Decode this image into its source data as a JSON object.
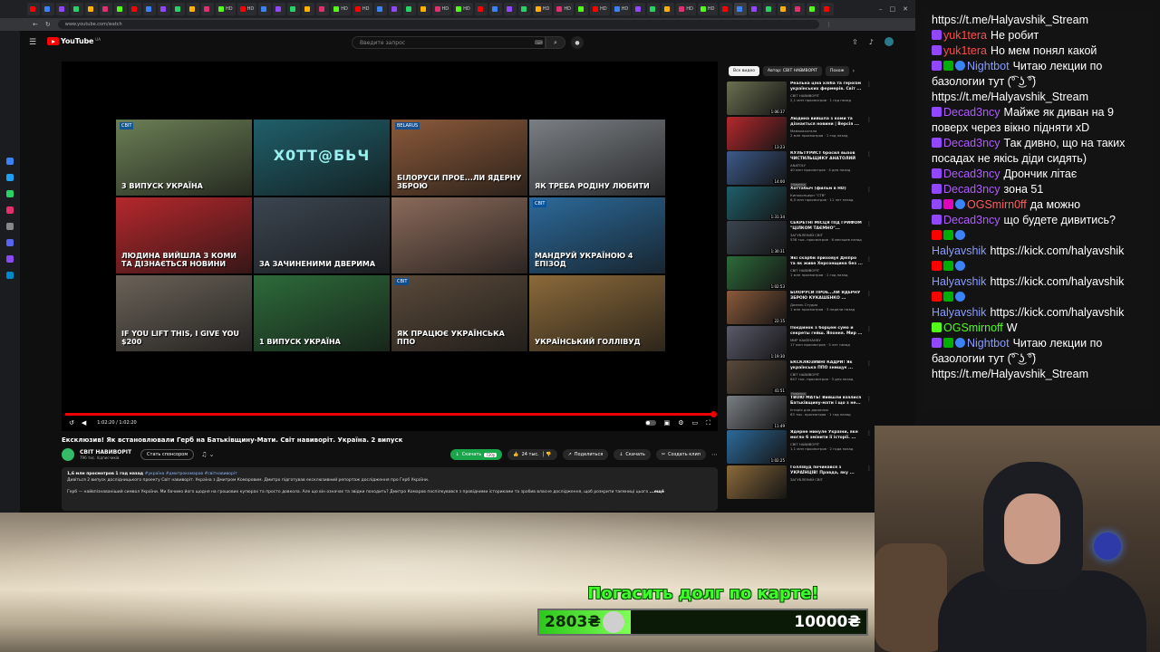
{
  "browser": {
    "tabs": [
      "",
      "",
      "",
      "",
      "",
      "",
      "",
      "",
      "",
      "",
      "",
      "",
      "",
      "HD",
      "HD",
      "",
      "",
      "",
      "",
      "",
      "HD",
      "HD",
      "",
      "",
      "",
      "",
      "HD",
      "HD",
      "",
      "",
      "",
      "",
      "HD",
      "HD",
      "",
      "HD",
      "HD",
      "",
      "",
      "",
      "HD",
      "HD",
      "",
      "",
      "",
      "",
      "",
      "",
      "",
      ""
    ],
    "url": "www.youtube.com/watch"
  },
  "youtube": {
    "logo": "YouTube",
    "logo_region": "UA",
    "search_placeholder": "Введите запрос",
    "player": {
      "time": "1:02:20 / 1:02:20",
      "progress": 1.0,
      "tiles": [
        {
          "badge": "СВІТ",
          "caption": "3 випуск Україна",
          "big": "",
          "bg": "#6b7f55"
        },
        {
          "badge": "",
          "caption": "",
          "big": "Х0ТТ@БЬЧ",
          "bg": "#1f5f6a"
        },
        {
          "badge": "BELARUS",
          "caption": "Білоруси прое...ли ядерну зброю",
          "big": "",
          "bg": "#8b5a3a"
        },
        {
          "badge": "",
          "caption": "Як треба родіну любити",
          "big": "",
          "bg": "#7a7f84"
        },
        {
          "badge": "",
          "caption": "Людина вийшла з коми та дізнається новини",
          "big": "",
          "bg": "#b5282c"
        },
        {
          "badge": "",
          "caption": "За зачиненими дверима",
          "big": "",
          "bg": "#3b4550"
        },
        {
          "badge": "",
          "caption": "",
          "big": "",
          "bg": "#8a6a5a"
        },
        {
          "badge": "СВІТ",
          "caption": "Мандруй Україною 4 епізод",
          "big": "",
          "bg": "#2c6a9a"
        },
        {
          "badge": "",
          "caption": "If you lift this, I give you $200",
          "big": "",
          "bg": "#6a6258"
        },
        {
          "badge": "",
          "caption": "1 випуск Україна",
          "big": "",
          "bg": "#2d6b3a"
        },
        {
          "badge": "СВІТ",
          "caption": "Як працює українська ППО",
          "big": "",
          "bg": "#5a4a3a"
        },
        {
          "badge": "",
          "caption": "Український Голлівуд",
          "big": "",
          "bg": "#8b6a3a"
        }
      ]
    },
    "video_title": "Ексклюзив! Як встановлювали Герб на Батьківщину-Мати. Світ навиворіт. Україна. 2 випуск",
    "channel": {
      "name": "СВІТ НАВИВОРІТ",
      "subs": "796 тис. підписчиків"
    },
    "sponsor_label": "Стать спонсором",
    "actions": {
      "download": "Скачать",
      "download_count": "720р",
      "likes": "24 тыс.",
      "share": "Поделиться",
      "save": "Скачать",
      "clip": "Создать клип"
    },
    "description": {
      "meta": "1,6 млн просмотров  1 год назад",
      "tags": "#україна #дмитрокомаров #світнавиворіт",
      "line1": "Дивіться 2 випуск дослідницького проекту Світ навиворіт. Україна з Дмитром Комаровим. Дмитро підготував ексклюзивний репортаж дослідження про Герб України.",
      "line2": "Герб — найвпізнаваніший символ України. Ми бачимо його щодня на грошових купюрах та просто довкола. Але що він означає та звідки походить? Дмитро Комаров поспілкувався з провідними істориками та зробив власне дослідження, щоб розкрити таємниці цього",
      "more": "...ещё"
    },
    "chips": [
      "Все видео",
      "Автор: СВІТ НАВИВОРІТ",
      "Похож"
    ],
    "recommendations": [
      {
        "title": "Реальна ціна хліба та героїзм українських фермерів. Світ ...",
        "channel": "СВІТ НАВИВОРІТ",
        "meta": "2,1 млн просмотров · 1 год назад",
        "duration": "1:06:37",
        "badge": "",
        "bg": "#6a7050"
      },
      {
        "title": "Людина вийшла з коми та дізнається новини | Версія ...",
        "channel": "Мамахохотала",
        "meta": "2 млн просмотров · 1 год назад",
        "duration": "13:23",
        "badge": "",
        "bg": "#b5282c"
      },
      {
        "title": "КУЛЬТУРИСТ бросил вызов ЧИСТИЛЬЩИКУ АНАТОЛИЙ",
        "channel": "ANATOLY",
        "meta": "40 млн просмотров · 4 дня назад",
        "duration": "14:00",
        "badge": "Новинка",
        "bg": "#3c5a8a"
      },
      {
        "title": "Хоттабыч (фильм в HD)",
        "channel": "Киноконцерн \"СТВ\"",
        "meta": "6,5 млн просмотров · 11 лет назад",
        "duration": "1:31:34",
        "badge": "",
        "bg": "#1f5f6a"
      },
      {
        "title": "СЕКРЕТНІ МІСЦЯ ПІД ГРИФОМ \"ЦІЛКОМ ТАЄМНО\"...",
        "channel": "ЗАГУБЛЕНИЙ СВІТ",
        "meta": "538 тыс. просмотров · 8 месяцев назад",
        "duration": "1:30:31",
        "badge": "",
        "bg": "#3b4550"
      },
      {
        "title": "Які скарби приховує Дніпро та як живе Херсонщина без ...",
        "channel": "СВІТ НАВИВОРІТ",
        "meta": "1 млн просмотров · 1 год назад",
        "duration": "1:02:53",
        "badge": "",
        "bg": "#2d6b3a"
      },
      {
        "title": "БІЛОРУСИ ПРОЕ...ЛИ ЯДЕРНУ ЗБРОЮ КУКАШЕНКО ...",
        "channel": "Дизель Студио",
        "meta": "1 млн просмотров · 3 недели назад",
        "duration": "22:15",
        "badge": "",
        "bg": "#8b5a3a"
      },
      {
        "title": "Поєдинок з борцем сумо и секреты гейш. Японня. Мир ...",
        "channel": "МИР НАИЗНАНКУ",
        "meta": "17 млн просмотров · 5 лет назад",
        "duration": "1:19:30",
        "badge": "",
        "bg": "#5a5a6a"
      },
      {
        "title": "ЕКСКЛЮЗИВНІ КАДРИ! Як українська ППО знищує ...",
        "channel": "СВІТ НАВИВОРІТ",
        "meta": "647 тыс. просмотров · 3 дня назад",
        "duration": "41:51",
        "badge": "Новинка",
        "bg": "#5a4a3a"
      },
      {
        "title": "ТВОЮ МАТЬ! Вийшли взялися Батьківщину-мати і що з не...",
        "channel": "Історія для дорослих",
        "meta": "63 тыс. просмотров · 1 год назад",
        "duration": "11:49",
        "badge": "",
        "bg": "#7a7f84"
      },
      {
        "title": "Ядерне минуле України, яке могло б змінити її історії. ...",
        "channel": "СВІТ НАВИВОРІТ",
        "meta": "1,1 млн просмотров · 2 года назад",
        "duration": "1:02:25",
        "badge": "",
        "bg": "#2c6a9a"
      },
      {
        "title": "Голлівуд починався з УКРАЇНЦІВ! Правда, яку ...",
        "channel": "ЗАГУБЛЕНИЙ СВІТ",
        "meta": "",
        "duration": "",
        "badge": "",
        "bg": "#8b6a3a"
      }
    ]
  },
  "chat": [
    {
      "user": "",
      "text": "https://t.me/Halyavshik_Stream",
      "color": "#ffffff",
      "icons": []
    },
    {
      "user": "yuk1tera",
      "text": "Не робит",
      "color": "#ff4b4b",
      "icons": [
        "tw"
      ]
    },
    {
      "user": "yuk1tera",
      "text": "Но мем понял какой",
      "color": "#ff4b4b",
      "icons": [
        "tw"
      ]
    },
    {
      "user": "Nightbot",
      "text": "Читаю лекции по базологии тут (͡° ͜ʖ ͡°) https://t.me/Halyavshik_Stream",
      "color": "#8a9cff",
      "icons": [
        "tw",
        "mod",
        "bot"
      ]
    },
    {
      "user": "Decad3ncy",
      "text": "Майже як диван на 9 поверх через вікно підняти xD",
      "color": "#b05cff",
      "icons": [
        "tw"
      ]
    },
    {
      "user": "Decad3ncy",
      "text": "Так дивно, що на таких посадах не якісь діди сидять)",
      "color": "#b05cff",
      "icons": [
        "tw"
      ]
    },
    {
      "user": "Decad3ncy",
      "text": "Дрончик літає",
      "color": "#b05cff",
      "icons": [
        "tw"
      ]
    },
    {
      "user": "Decad3ncy",
      "text": "зона 51",
      "color": "#b05cff",
      "icons": [
        "tw"
      ]
    },
    {
      "user": "OGSmirn0ff",
      "text": "да можно",
      "color": "#ff5e5e",
      "icons": [
        "tw",
        "vip",
        "bot"
      ]
    },
    {
      "user": "Decad3ncy",
      "text": "що будете дивитись?",
      "color": "#b05cff",
      "icons": [
        "tw"
      ]
    },
    {
      "user": "Halyavshik",
      "text": "https://kick.com/halyavshik",
      "color": "#8a9cff",
      "icons": [
        "yt",
        "mod",
        "bot"
      ]
    },
    {
      "user": "Halyavshik",
      "text": "https://kick.com/halyavshik",
      "color": "#8a9cff",
      "icons": [
        "yt",
        "mod",
        "bot"
      ]
    },
    {
      "user": "Halyavshik",
      "text": "https://kick.com/halyavshik",
      "color": "#8a9cff",
      "icons": [
        "yt",
        "mod",
        "bot"
      ]
    },
    {
      "user": "OGSmirnoff",
      "text": "W",
      "color": "#53fc18",
      "icons": [
        "kick"
      ]
    },
    {
      "user": "Nightbot",
      "text": "Читаю лекции по базологии тут (͡° ͜ʖ ͡°) https://t.me/Halyavshik_Stream",
      "color": "#8a9cff",
      "icons": [
        "tw",
        "mod",
        "bot"
      ]
    }
  ],
  "goal": {
    "title": "Погасить долг по карте!",
    "current": "2803₴",
    "target": "10000₴",
    "progress": 0.2803
  }
}
